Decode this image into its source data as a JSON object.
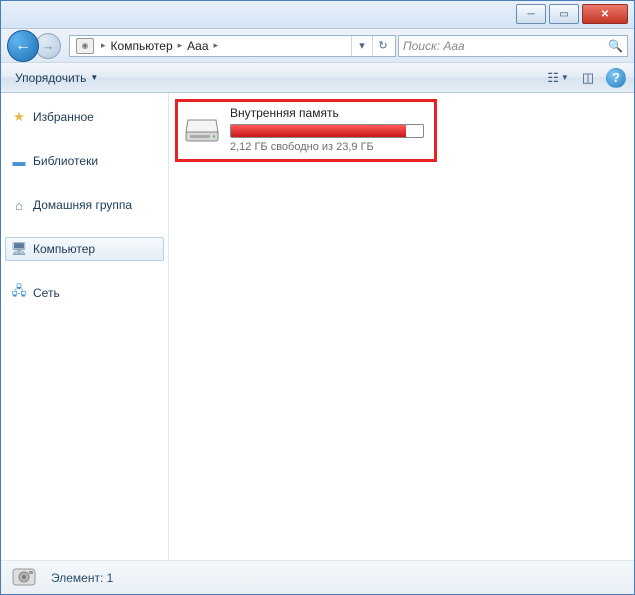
{
  "breadcrumb": {
    "seg1": "Компьютер",
    "seg2": "Aaa"
  },
  "search": {
    "placeholder": "Поиск: Aaa"
  },
  "toolbar": {
    "organize": "Упорядочить"
  },
  "sidebar": {
    "favorites": "Избранное",
    "libraries": "Библиотеки",
    "homegroup": "Домашняя группа",
    "computer": "Компьютер",
    "network": "Сеть"
  },
  "drive": {
    "name": "Внутренняя память",
    "free_text": "2,12 ГБ свободно из 23,9 ГБ",
    "fill_percent": "91"
  },
  "status": {
    "text": "Элемент: 1"
  }
}
